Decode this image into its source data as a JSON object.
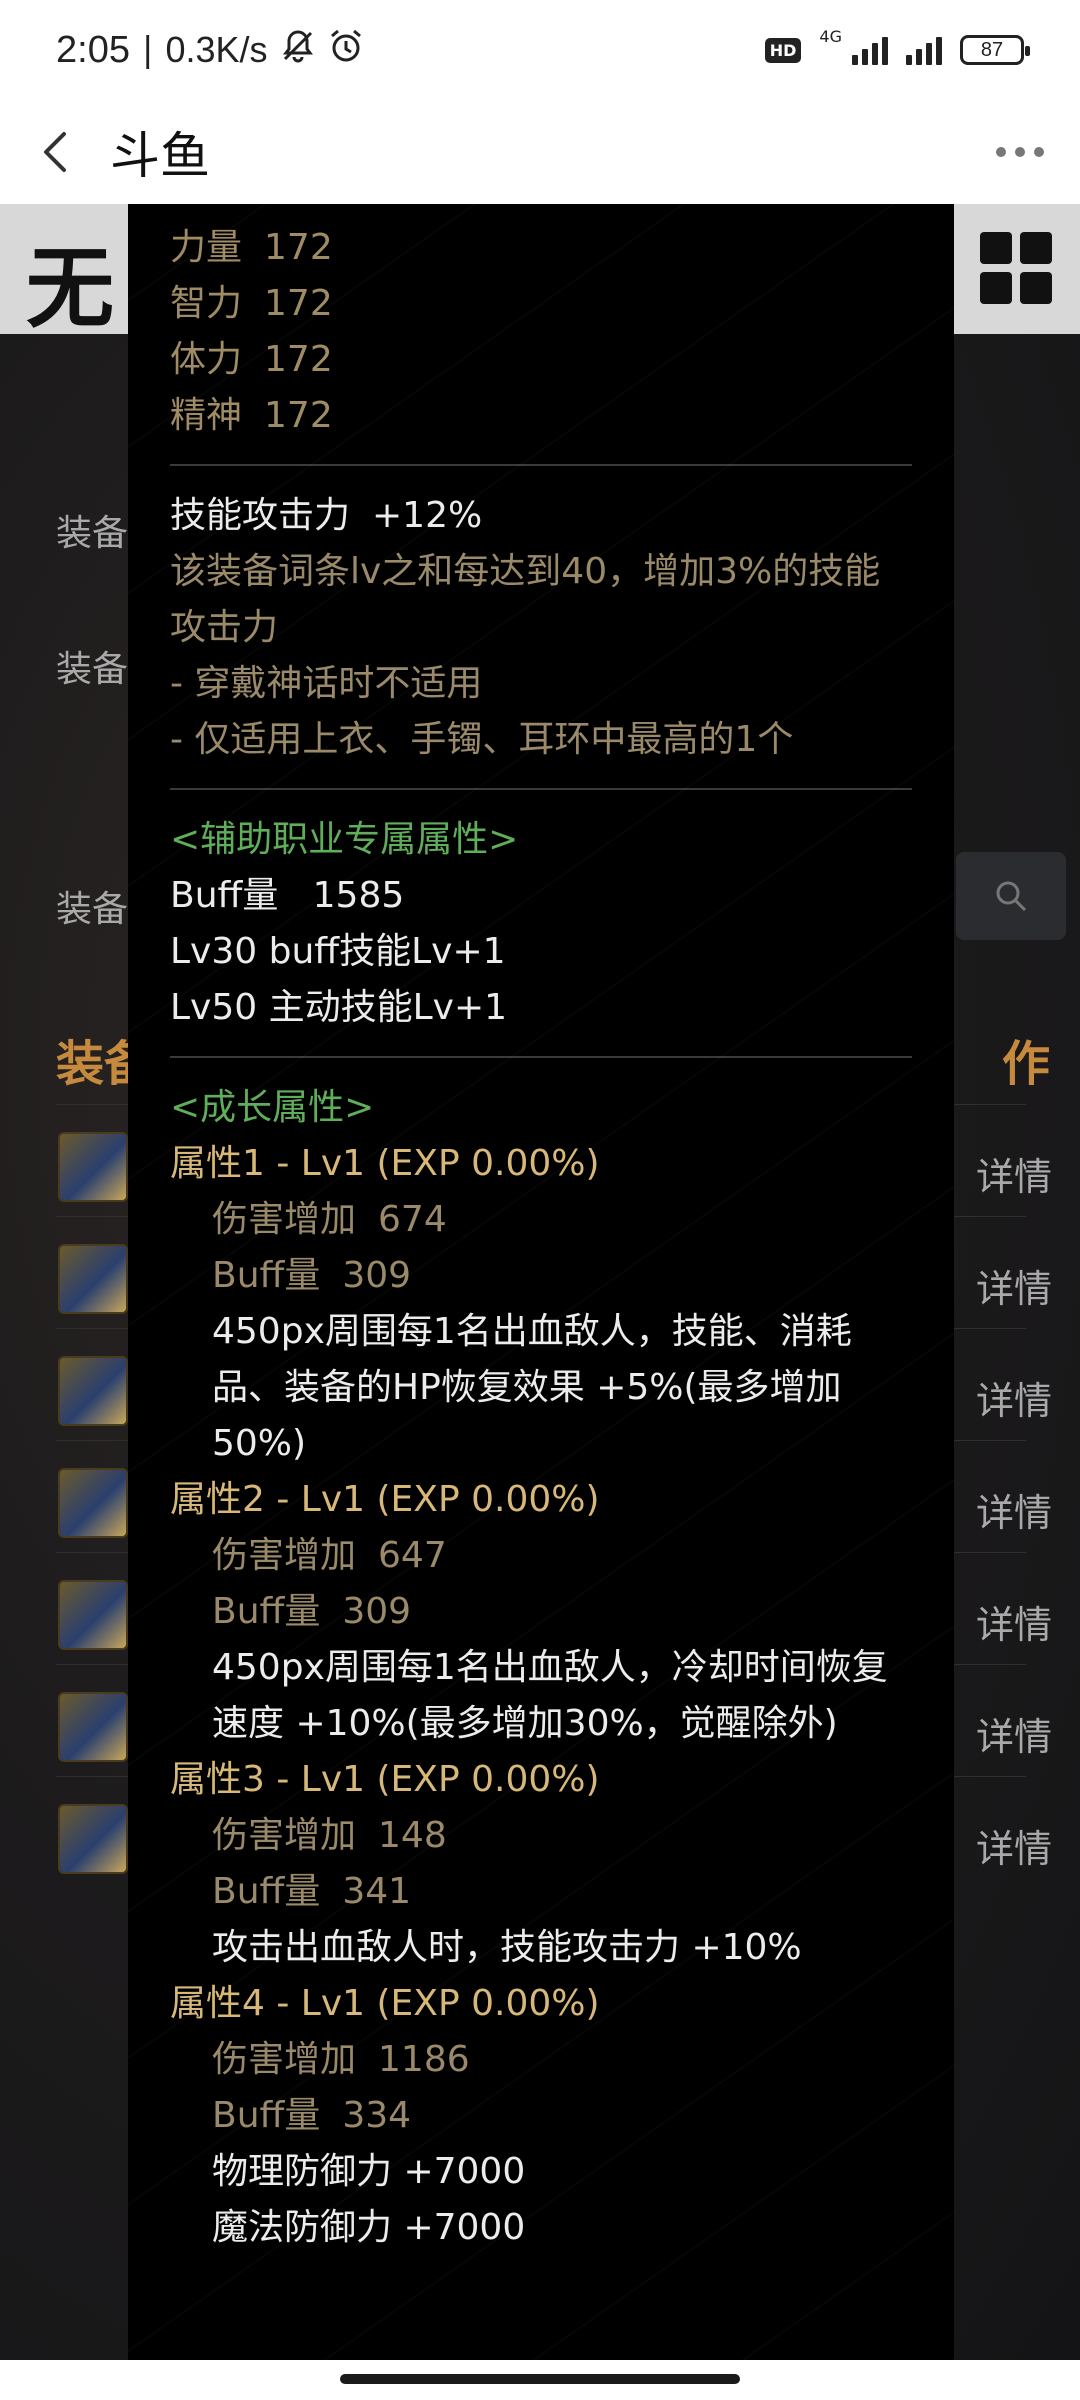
{
  "status_bar": {
    "time": "2:05",
    "separator": "|",
    "net_speed": "0.3K/s",
    "network_type": "4G",
    "hd_badge": "HD",
    "battery": "87",
    "icons": [
      "mute-bell-icon",
      "alarm-icon",
      "signal-icon",
      "battery-icon"
    ]
  },
  "title_bar": {
    "title": "斗鱼",
    "back_icon": "chevron-left-icon",
    "more_icon": "more-dots-icon"
  },
  "background_page": {
    "logo": "无",
    "labels": [
      "装备",
      "装备",
      "装备"
    ],
    "heading_left": "装备",
    "heading_right": "作",
    "detail_label": "详情",
    "search_icon": "search-icon",
    "rows": 7
  },
  "tooltip": {
    "base_stats": [
      {
        "name": "力量",
        "value": "172"
      },
      {
        "name": "智力",
        "value": "172"
      },
      {
        "name": "体力",
        "value": "172"
      },
      {
        "name": "精神",
        "value": "172"
      }
    ],
    "skill_attack": {
      "title": "技能攻击力",
      "value": "+12%",
      "desc": "该装备词条lv之和每达到40，增加3%的技能攻击力",
      "notes": [
        "- 穿戴神话时不适用",
        "- 仅适用上衣、手镯、耳环中最高的1个"
      ]
    },
    "support": {
      "heading": "<辅助职业专属属性>",
      "lines": [
        "Buff量   1585",
        "Lv30 buff技能Lv+1",
        "Lv50 主动技能Lv+1"
      ]
    },
    "growth": {
      "heading": "<成长属性>",
      "attrs": [
        {
          "title": "属性1 - Lv1 (EXP 0.00%)",
          "damage_label": "伤害增加",
          "damage": "674",
          "buff_label": "Buff量",
          "buff": "309",
          "effects": [
            "450px周围每1名出血敌人，技能、消耗品、装备的HP恢复效果 +5%(最多增加50%)"
          ]
        },
        {
          "title": "属性2 - Lv1 (EXP 0.00%)",
          "damage_label": "伤害增加",
          "damage": "647",
          "buff_label": "Buff量",
          "buff": "309",
          "effects": [
            "450px周围每1名出血敌人，冷却时间恢复速度 +10%(最多增加30%，觉醒除外)"
          ]
        },
        {
          "title": "属性3 - Lv1 (EXP 0.00%)",
          "damage_label": "伤害增加",
          "damage": "148",
          "buff_label": "Buff量",
          "buff": "341",
          "effects": [
            "攻击出血敌人时，技能攻击力 +10%"
          ]
        },
        {
          "title": "属性4 - Lv1 (EXP 0.00%)",
          "damage_label": "伤害增加",
          "damage": "1186",
          "buff_label": "Buff量",
          "buff": "334",
          "effects": [
            "物理防御力 +7000",
            "魔法防御力 +7000"
          ]
        }
      ]
    }
  },
  "colors": {
    "tooltip_bg": "#000000",
    "stat_text": "#a08c64",
    "green_heading": "#5fae5a",
    "gold_attr": "#d8b878",
    "white_text": "#ececec",
    "bg_accent": "#c58a3d"
  }
}
